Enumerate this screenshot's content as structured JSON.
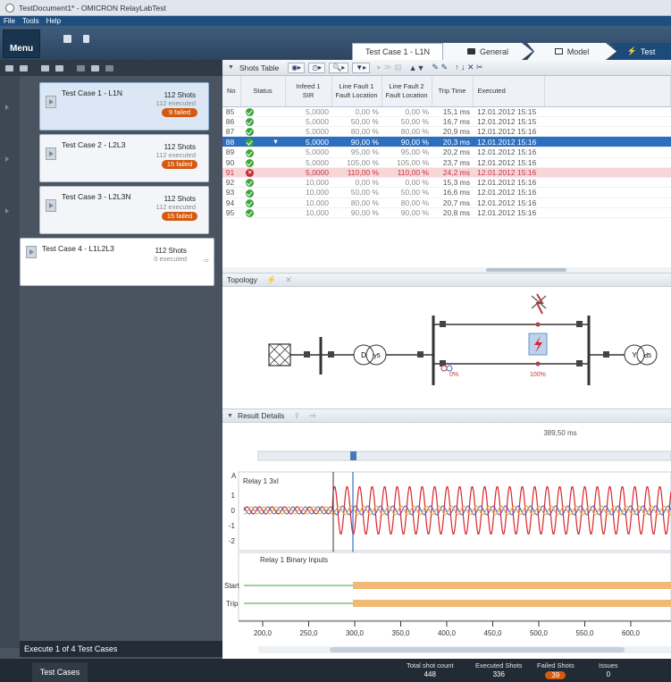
{
  "window": {
    "title": "TestDocument1* - OMICRON RelayLabTest"
  },
  "menu": {
    "items": [
      "File",
      "Tools",
      "Help"
    ],
    "menu_button": "Menu"
  },
  "tabs": {
    "test_case": "Test Case 1 - L1N",
    "general": "General",
    "model": "Model",
    "test": "Test"
  },
  "test_cases": [
    {
      "name": "Test Case 1 - L1N",
      "shots": "112 Shots",
      "executed": "112 executed",
      "failed": "9 failed",
      "selected": true
    },
    {
      "name": "Test Case 2 - L2L3",
      "shots": "112 Shots",
      "executed": "112 executed",
      "failed": "15 failed",
      "selected": false
    },
    {
      "name": "Test Case 3 - L2L3N",
      "shots": "112 Shots",
      "executed": "112 executed",
      "failed": "15 failed",
      "selected": false
    },
    {
      "name": "Test Case 4 - L1L2L3",
      "shots": "112 Shots",
      "executed": "0 executed",
      "failed": "",
      "selected": false
    }
  ],
  "left": {
    "execute_label": "Execute 1 of 4 Test Cases",
    "bottom_tab": "Test Cases"
  },
  "shots_table": {
    "label": "Shots Table",
    "columns": [
      "No",
      "Status",
      "Infeed 1\nSIR",
      "Line Fault 1\nFault Location",
      "Line Fault 2\nFault Location",
      "Trip Time",
      "Executed"
    ],
    "rows": [
      {
        "no": "85",
        "status": "ok",
        "sir": "5,0000",
        "lf1": "0,00 %",
        "lf2": "0,00 %",
        "trip": "15,1 ms",
        "executed": "12.01.2012 15:15"
      },
      {
        "no": "86",
        "status": "ok",
        "sir": "5,0000",
        "lf1": "50,00 %",
        "lf2": "50,00 %",
        "trip": "16,7 ms",
        "executed": "12.01.2012 15:15"
      },
      {
        "no": "87",
        "status": "ok",
        "sir": "5,0000",
        "lf1": "80,00 %",
        "lf2": "80,00 %",
        "trip": "20,9 ms",
        "executed": "12.01.2012 15:16"
      },
      {
        "no": "88",
        "status": "ok",
        "sir": "5,0000",
        "lf1": "90,00 %",
        "lf2": "90,00 %",
        "trip": "20,3 ms",
        "executed": "12.01.2012 15:16",
        "selected": true
      },
      {
        "no": "89",
        "status": "ok",
        "sir": "5,0000",
        "lf1": "95,00 %",
        "lf2": "95,00 %",
        "trip": "20,2 ms",
        "executed": "12.01.2012 15:16"
      },
      {
        "no": "90",
        "status": "ok",
        "sir": "5,0000",
        "lf1": "105,00 %",
        "lf2": "105,00 %",
        "trip": "23,7 ms",
        "executed": "12.01.2012 15:16"
      },
      {
        "no": "91",
        "status": "fail",
        "sir": "5,0000",
        "lf1": "110,00 %",
        "lf2": "110,00 %",
        "trip": "24,2 ms",
        "executed": "12.01.2012 15:16",
        "error": true
      },
      {
        "no": "92",
        "status": "ok",
        "sir": "10,000",
        "lf1": "0,00 %",
        "lf2": "0,00 %",
        "trip": "15,3 ms",
        "executed": "12.01.2012 15:16"
      },
      {
        "no": "93",
        "status": "ok",
        "sir": "10,000",
        "lf1": "50,00 %",
        "lf2": "50,00 %",
        "trip": "16,6 ms",
        "executed": "12.01.2012 15:16"
      },
      {
        "no": "94",
        "status": "ok",
        "sir": "10,000",
        "lf1": "80,00 %",
        "lf2": "80,00 %",
        "trip": "20,7 ms",
        "executed": "12.01.2012 15:16"
      },
      {
        "no": "95",
        "status": "ok",
        "sir": "10,000",
        "lf1": "90,00 %",
        "lf2": "90,00 %",
        "trip": "20,8 ms",
        "executed": "12.01.2012 15:16"
      }
    ]
  },
  "topology": {
    "label": "Topology",
    "fault1_pos": "0%",
    "fault2_pos": "100%",
    "trafo1": [
      "D",
      "y5"
    ],
    "trafo2": [
      "Y",
      "d5"
    ]
  },
  "result": {
    "label": "Result Details",
    "cursor_time": "389,50 ms",
    "y_unit": "A",
    "y_ticks": [
      "1",
      "0",
      "-1",
      "-2"
    ],
    "trace_label": "Relay 1 3xI",
    "binary_label": "Relay 1 Binary Inputs",
    "binary_channels": [
      "Start",
      "Trip"
    ],
    "x_ticks": [
      "200,0",
      "250,0",
      "300,0",
      "350,0",
      "400,0",
      "450,0",
      "500,0",
      "550,0",
      "600,0"
    ]
  },
  "status": {
    "total_label": "Total shot count",
    "total": "448",
    "executed_label": "Executed Shots",
    "executed": "336",
    "failed_label": "Failed Shots",
    "failed": "39",
    "issues_label": "Issues",
    "issues": "0"
  },
  "colors": {
    "accent": "#1f4f80",
    "failed": "#d45a11",
    "ok": "#3aa53a",
    "error": "#c92c35",
    "selection": "#2d6fbf"
  }
}
